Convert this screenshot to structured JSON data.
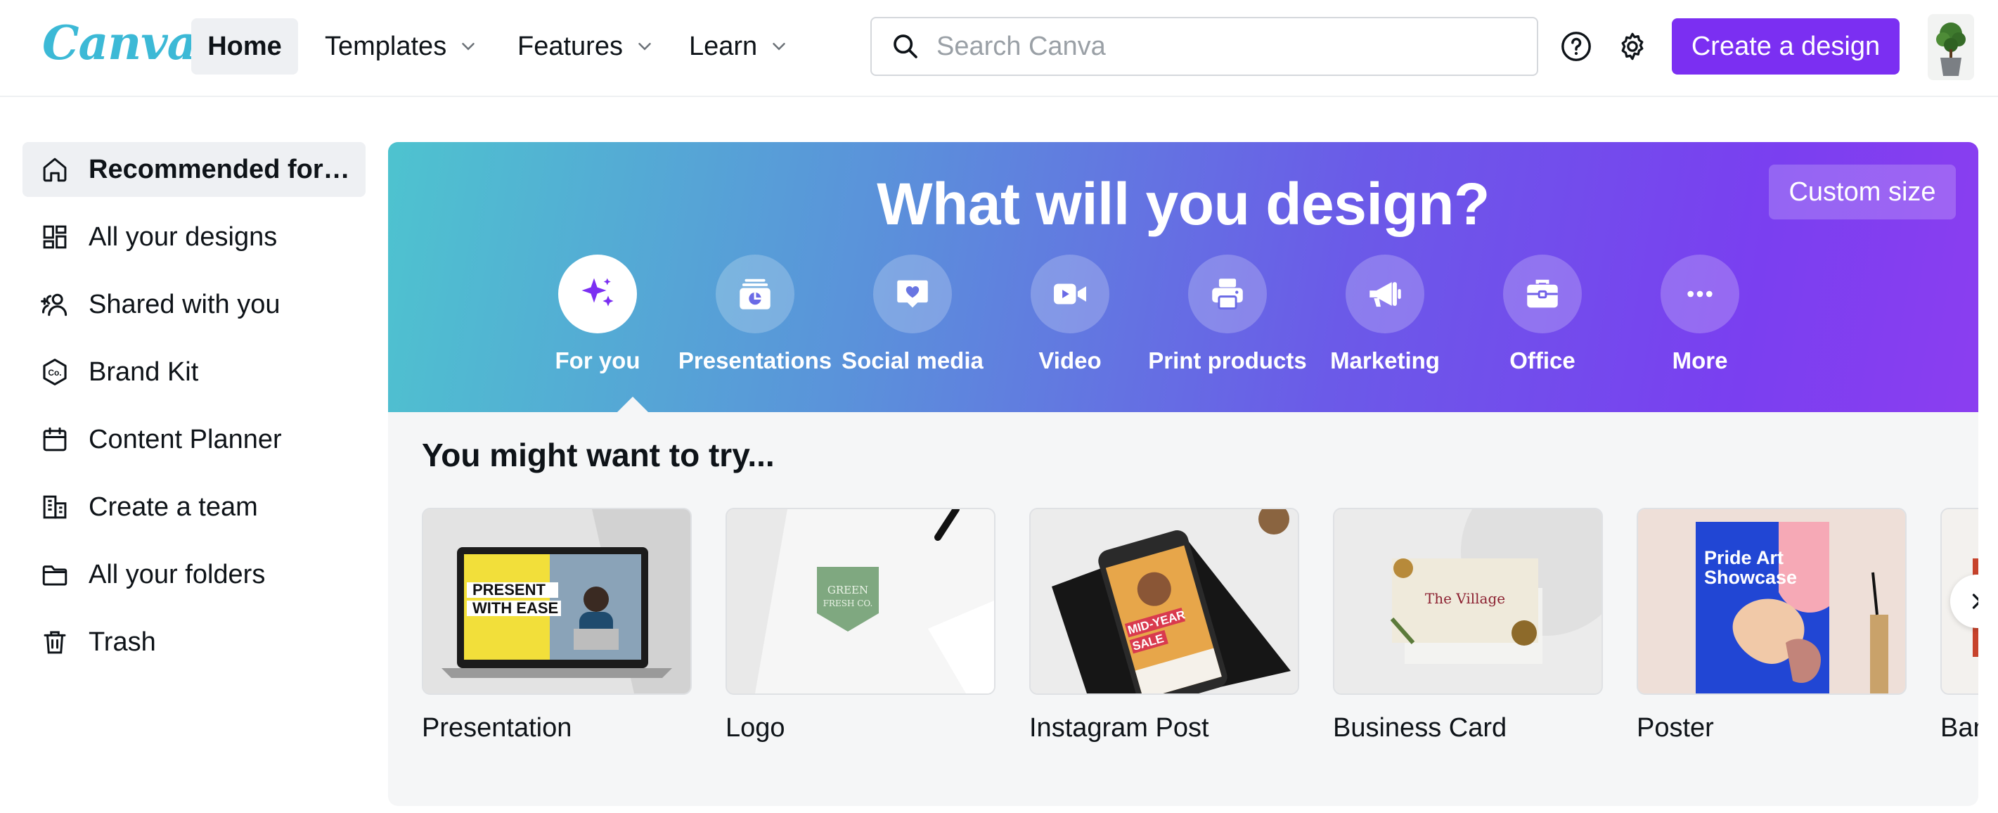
{
  "app": {
    "logo_text": "Canva"
  },
  "nav": {
    "home": "Home",
    "templates": "Templates",
    "features": "Features",
    "learn": "Learn"
  },
  "search": {
    "placeholder": "Search Canva"
  },
  "header": {
    "create_label": "Create a design"
  },
  "sidebar": {
    "items": [
      {
        "label": "Recommended for you",
        "icon": "home-icon",
        "active": true
      },
      {
        "label": "All your designs",
        "icon": "grid-icon"
      },
      {
        "label": "Shared with you",
        "icon": "people-icon"
      },
      {
        "label": "Brand Kit",
        "icon": "brand-kit-icon"
      },
      {
        "label": "Content Planner",
        "icon": "calendar-icon"
      },
      {
        "label": "Create a team",
        "icon": "building-icon"
      },
      {
        "label": "All your folders",
        "icon": "folder-icon"
      },
      {
        "label": "Trash",
        "icon": "trash-icon"
      }
    ]
  },
  "hero": {
    "title": "What will you design?",
    "custom_size": "Custom size",
    "categories": [
      {
        "label": "For you",
        "icon": "sparkle-icon",
        "active": true
      },
      {
        "label": "Presentations",
        "icon": "presentation-icon"
      },
      {
        "label": "Social media",
        "icon": "heart-chat-icon"
      },
      {
        "label": "Video",
        "icon": "video-camera-icon"
      },
      {
        "label": "Print products",
        "icon": "printer-icon"
      },
      {
        "label": "Marketing",
        "icon": "megaphone-icon"
      },
      {
        "label": "Office",
        "icon": "briefcase-icon"
      },
      {
        "label": "More",
        "icon": "more-dots-icon"
      }
    ]
  },
  "suggestions": {
    "title": "You might want to try...",
    "cards": [
      {
        "label": "Presentation",
        "thumb_text": [
          "PRESENT",
          "WITH EASE"
        ]
      },
      {
        "label": "Logo",
        "thumb_text": [
          "GREEN",
          "FRESH CO."
        ]
      },
      {
        "label": "Instagram Post",
        "thumb_text": [
          "MID-YEAR",
          "SALE"
        ]
      },
      {
        "label": "Business Card",
        "thumb_text": [
          "The Village"
        ]
      },
      {
        "label": "Poster",
        "thumb_text": [
          "Pride Art",
          "Showcase"
        ]
      },
      {
        "label": "Ban"
      }
    ]
  },
  "colors": {
    "accent": "#7b2ff2",
    "hero_start": "#4ec3cf",
    "hero_end": "#8b3ef0"
  }
}
